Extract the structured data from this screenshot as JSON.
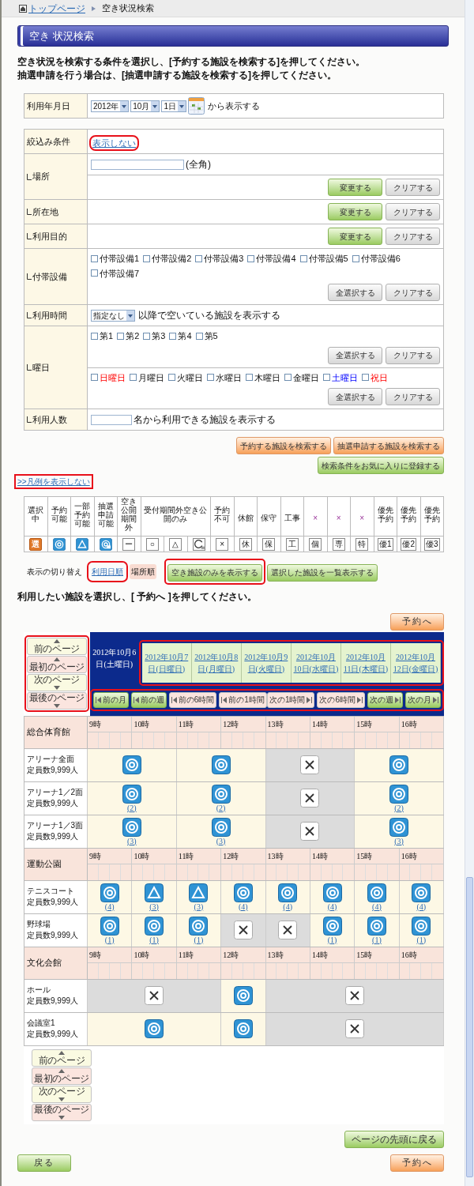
{
  "breadcrumb": {
    "home": "トップページ",
    "current": "空き状況検索"
  },
  "title": "空き 状況検索",
  "instructions": [
    "空き状況を検索する条件を選択し、[予約する施設を検索する]を押してください。",
    "抽選申請を行う場合は、[抽選申請する施設を検索する]を押してください。"
  ],
  "date_filter": {
    "label": "利用年月日",
    "selects": [
      "2012年",
      "10月",
      "1日"
    ],
    "suffix": "から表示する"
  },
  "filters": {
    "label": "絞込み条件",
    "toggle": {
      "label": "表示しない",
      "highlighted": true
    },
    "rows": [
      {
        "label": "場所",
        "sections": [
          {
            "field": {
              "suffix": "(全角)"
            }
          },
          {
            "buttons": [
              {
                "label": "変更する",
                "kind": "green"
              },
              {
                "label": "クリアする",
                "kind": "gray"
              }
            ]
          }
        ]
      },
      {
        "label": "所在地",
        "sections": [
          {
            "buttons": [
              {
                "label": "変更する",
                "kind": "green"
              },
              {
                "label": "クリアする",
                "kind": "gray"
              }
            ]
          }
        ]
      },
      {
        "label": "利用目的",
        "sections": [
          {
            "buttons": [
              {
                "label": "変更する",
                "kind": "green"
              },
              {
                "label": "クリアする",
                "kind": "gray"
              }
            ]
          }
        ]
      },
      {
        "label": "付帯設備",
        "sections": [
          {
            "checkboxes": [
              {
                "label": "付帯設備1",
                "checked": false
              },
              {
                "label": "付帯設備2",
                "checked": false
              },
              {
                "label": "付帯設備3",
                "checked": false
              },
              {
                "label": "付帯設備4",
                "checked": false
              },
              {
                "label": "付帯設備5",
                "checked": false
              },
              {
                "label": "付帯設備6",
                "checked": false
              },
              {
                "label": "付帯設備7",
                "checked": false
              }
            ],
            "buttons": [
              {
                "label": "全選択する",
                "kind": "gray"
              },
              {
                "label": "クリアする",
                "kind": "gray"
              }
            ]
          }
        ]
      },
      {
        "label": "利用時間",
        "sections": [
          {
            "select": {
              "value": "指定なし",
              "suffix": "以降で空いている施設を表示する"
            }
          }
        ]
      },
      {
        "label": "曜日",
        "sections": [
          {
            "checkboxes": [
              {
                "label": "第1",
                "checked": false
              },
              {
                "label": "第2",
                "checked": false
              },
              {
                "label": "第3",
                "checked": false
              },
              {
                "label": "第4",
                "checked": false
              },
              {
                "label": "第5",
                "checked": false
              }
            ],
            "buttons": [
              {
                "label": "全選択する",
                "kind": "gray"
              },
              {
                "label": "クリアする",
                "kind": "gray"
              }
            ]
          },
          {
            "checkboxes": [
              {
                "label": "日曜日",
                "checked": false,
                "kind": "holiday"
              },
              {
                "label": "月曜日",
                "checked": false,
                "kind": "weekday"
              },
              {
                "label": "火曜日",
                "checked": false,
                "kind": "weekday"
              },
              {
                "label": "水曜日",
                "checked": false,
                "kind": "weekday"
              },
              {
                "label": "木曜日",
                "checked": false,
                "kind": "weekday"
              },
              {
                "label": "金曜日",
                "checked": false,
                "kind": "weekday"
              },
              {
                "label": "土曜日",
                "checked": false,
                "kind": "saturday"
              },
              {
                "label": "祝日",
                "checked": false,
                "kind": "holiday"
              }
            ],
            "buttons": [
              {
                "label": "全選択する",
                "kind": "gray"
              },
              {
                "label": "クリアする",
                "kind": "gray"
              }
            ]
          }
        ]
      },
      {
        "label": "利用人数",
        "sections": [
          {
            "field": {
              "suffix": "名から利用できる施設を表示する"
            }
          }
        ]
      }
    ]
  },
  "search_actions": [
    {
      "label": "予約する施設を検索する",
      "kind": "orange"
    },
    {
      "label": "抽選申請する施設を検索する",
      "kind": "orange"
    },
    {
      "label": "検索条件をお気に入りに登録する",
      "kind": "green"
    }
  ],
  "legend": {
    "toggle": {
      "label": ">>凡例を表示しない",
      "highlighted": true
    },
    "columns": [
      {
        "header": "選択中",
        "symbols": [
          {
            "kind": "selected",
            "text": "選"
          }
        ]
      },
      {
        "header": "予約可能",
        "symbols": [
          {
            "kind": "available"
          }
        ]
      },
      {
        "header": "一部予約可能",
        "symbols": [
          {
            "kind": "partial"
          }
        ]
      },
      {
        "header": "抽選申請可能",
        "symbols": [
          {
            "kind": "lottery"
          }
        ]
      },
      {
        "header": "空き公開期間外",
        "symbols": [
          {
            "kind": "box",
            "text": "ー"
          }
        ]
      },
      {
        "header": "受付期間外空き公開のみ",
        "symbols": [
          {
            "kind": "box",
            "text": "○"
          },
          {
            "kind": "box",
            "text": "△"
          },
          {
            "kind": "open-lottery"
          }
        ]
      },
      {
        "header": "予約不可",
        "symbols": [
          {
            "kind": "box",
            "text": "×"
          }
        ]
      },
      {
        "header": "休館",
        "symbols": [
          {
            "kind": "box",
            "text": "休"
          }
        ]
      },
      {
        "header": "保守",
        "symbols": [
          {
            "kind": "box",
            "text": "保"
          }
        ]
      },
      {
        "header": "工事",
        "symbols": [
          {
            "kind": "box",
            "text": "工"
          }
        ]
      },
      {
        "header": "×",
        "symbols": [
          {
            "kind": "box",
            "text": "個"
          }
        ]
      },
      {
        "header": "×",
        "symbols": [
          {
            "kind": "box",
            "text": "専"
          }
        ]
      },
      {
        "header": "×",
        "symbols": [
          {
            "kind": "box",
            "text": "特"
          }
        ]
      },
      {
        "header": "優先予約",
        "symbols": [
          {
            "kind": "box",
            "text": "優1"
          }
        ]
      },
      {
        "header": "優先予約",
        "symbols": [
          {
            "kind": "box",
            "text": "優2"
          }
        ]
      },
      {
        "header": "優先予約",
        "symbols": [
          {
            "kind": "box",
            "text": "優3"
          }
        ]
      }
    ]
  },
  "view_toggle": {
    "label": "表示の切り替え",
    "options": [
      {
        "label": "利用日順",
        "selected": false,
        "highlighted": true
      },
      {
        "label": "場所順",
        "selected": true,
        "highlighted": false
      }
    ],
    "buttons": [
      {
        "label": "空き施設のみを表示する",
        "kind": "green",
        "highlighted": true
      },
      {
        "label": "選択した施設を一覧表示する",
        "kind": "green",
        "highlighted": false
      }
    ]
  },
  "instruction2": "利用したい施設を選択し、[ 予約へ ]を押してください。",
  "reserve_top": "予約へ",
  "calendar": {
    "pager": {
      "highlighted": true,
      "buttons": [
        {
          "label": "前のページ",
          "kind": "prev"
        },
        {
          "label": "最初のページ",
          "kind": "first"
        },
        {
          "label": "次のページ",
          "kind": "next"
        },
        {
          "label": "最後のページ",
          "kind": "last"
        }
      ]
    },
    "dates_highlighted": true,
    "dates": [
      {
        "label": "2012年10月6日(土曜日)",
        "selected": true
      },
      {
        "label": "2012年10月7日(日曜日)",
        "selected": false
      },
      {
        "label": "2012年10月8日(月曜日)",
        "selected": false
      },
      {
        "label": "2012年10月9日(火曜日)",
        "selected": false
      },
      {
        "label": "2012年10月10日(水曜日)",
        "selected": false
      },
      {
        "label": "2012年10月11日(木曜日)",
        "selected": false
      },
      {
        "label": "2012年10月12日(金曜日)",
        "selected": false
      }
    ],
    "nav": {
      "highlighted": true,
      "buttons": [
        {
          "label": "前の月",
          "kind": "prev-month"
        },
        {
          "label": "前の週",
          "kind": "prev-week"
        },
        {
          "label": "前の6時間",
          "kind": "prev-hours"
        },
        {
          "label": "前の1時間",
          "kind": "prev-hours"
        },
        {
          "label": "次の1時間",
          "kind": "next-hours"
        },
        {
          "label": "次の6時間",
          "kind": "next-hours"
        },
        {
          "label": "次の週",
          "kind": "next-week"
        },
        {
          "label": "次の月",
          "kind": "next-month"
        }
      ]
    }
  },
  "sections": [
    {
      "name": "総合体育館",
      "hours": [
        "9時",
        "10時",
        "11時",
        "12時",
        "13時",
        "14時",
        "15時",
        "16時"
      ],
      "facilities": [
        {
          "name": "アリーナ全面",
          "capacity": "定員数9,999人",
          "slots": [
            {
              "kind": "available"
            },
            {
              "kind": "continued"
            },
            {
              "kind": "available"
            },
            {
              "kind": "continued"
            },
            {
              "kind": "unavailable"
            },
            {
              "kind": "continued"
            },
            {
              "kind": "available"
            },
            {
              "kind": "continued"
            }
          ]
        },
        {
          "name": "アリーナ1／2面",
          "capacity": "定員数9,999人",
          "slots": [
            {
              "kind": "available",
              "count": "(2)"
            },
            {
              "kind": "continued"
            },
            {
              "kind": "available",
              "count": "(2)"
            },
            {
              "kind": "continued"
            },
            {
              "kind": "unavailable"
            },
            {
              "kind": "continued"
            },
            {
              "kind": "available",
              "count": "(2)"
            },
            {
              "kind": "continued"
            }
          ]
        },
        {
          "name": "アリーナ1／3面",
          "capacity": "定員数9,999人",
          "slots": [
            {
              "kind": "available",
              "count": "(3)"
            },
            {
              "kind": "continued"
            },
            {
              "kind": "available",
              "count": "(3)"
            },
            {
              "kind": "continued"
            },
            {
              "kind": "unavailable"
            },
            {
              "kind": "continued"
            },
            {
              "kind": "available",
              "count": "(3)"
            },
            {
              "kind": "continued"
            }
          ]
        }
      ]
    },
    {
      "name": "運動公園",
      "hours": [
        "9時",
        "10時",
        "11時",
        "12時",
        "13時",
        "14時",
        "15時",
        "16時"
      ],
      "facilities": [
        {
          "name": "テニスコート",
          "capacity": "定員数9,999人",
          "slots": [
            {
              "kind": "available",
              "count": "(4)"
            },
            {
              "kind": "partial",
              "count": "(3)"
            },
            {
              "kind": "partial",
              "count": "(3)"
            },
            {
              "kind": "available",
              "count": "(4)"
            },
            {
              "kind": "available",
              "count": "(4)"
            },
            {
              "kind": "available",
              "count": "(4)"
            },
            {
              "kind": "available",
              "count": "(4)"
            },
            {
              "kind": "available",
              "count": "(4)"
            }
          ]
        },
        {
          "name": "野球場",
          "capacity": "定員数9,999人",
          "slots": [
            {
              "kind": "available",
              "count": "(1)"
            },
            {
              "kind": "available",
              "count": "(1)"
            },
            {
              "kind": "available",
              "count": "(1)"
            },
            {
              "kind": "unavailable"
            },
            {
              "kind": "unavailable"
            },
            {
              "kind": "available",
              "count": "(1)"
            },
            {
              "kind": "available",
              "count": "(1)"
            },
            {
              "kind": "available",
              "count": "(1)"
            }
          ]
        }
      ]
    },
    {
      "name": "文化会館",
      "hours": [
        "9時",
        "10時",
        "11時",
        "12時",
        "13時",
        "14時",
        "15時",
        "16時"
      ],
      "facilities": [
        {
          "name": "ホール",
          "capacity": "定員数9,999人",
          "slots": [
            {
              "kind": "unavailable"
            },
            {
              "kind": "continued"
            },
            {
              "kind": "continued"
            },
            {
              "kind": "available"
            },
            {
              "kind": "unavailable"
            },
            {
              "kind": "continued"
            },
            {
              "kind": "continued"
            },
            {
              "kind": "continued"
            }
          ]
        },
        {
          "name": "会議室1",
          "capacity": "定員数9,999人",
          "slots": [
            {
              "kind": "available"
            },
            {
              "kind": "continued"
            },
            {
              "kind": "continued"
            },
            {
              "kind": "available"
            },
            {
              "kind": "unavailable"
            },
            {
              "kind": "continued"
            },
            {
              "kind": "continued"
            },
            {
              "kind": "continued"
            }
          ]
        }
      ]
    }
  ],
  "bottom_pager": [
    {
      "label": "前のページ",
      "kind": "prev"
    },
    {
      "label": "最初のページ",
      "kind": "first"
    },
    {
      "label": "次のページ",
      "kind": "next"
    },
    {
      "label": "最後のページ",
      "kind": "last"
    }
  ],
  "footer": {
    "top_link": {
      "label": "ページの先頭に戻る",
      "kind": "green"
    },
    "back": {
      "label": "戻る",
      "kind": "green"
    },
    "reserve": {
      "label": "予約へ",
      "kind": "orange"
    }
  }
}
